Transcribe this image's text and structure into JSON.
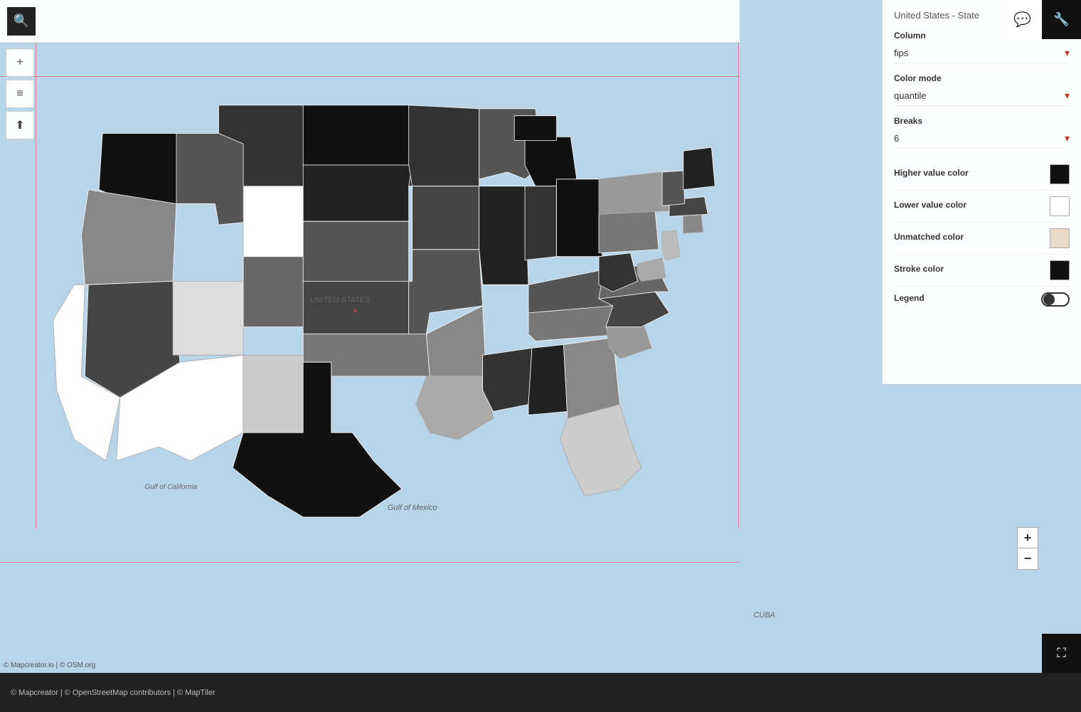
{
  "header": {
    "title": "United States - State"
  },
  "toolbar": {
    "search_icon": "🔍",
    "zoom_in_label": "+",
    "zoom_out_label": "−",
    "layers_icon": "≡",
    "upload_icon": "⬆",
    "settings_icon": "🔧",
    "comment_icon": "💬"
  },
  "panel": {
    "title": "United States - State",
    "column_label": "Column",
    "column_value": "fips",
    "color_mode_label": "Color mode",
    "color_mode_value": "quantile",
    "breaks_label": "Breaks",
    "breaks_value": "6",
    "higher_value_color_label": "Higher value color",
    "higher_value_color": "#111111",
    "lower_value_color_label": "Lower value color",
    "lower_value_color": "#ffffff",
    "unmatched_color_label": "Unmatched color",
    "unmatched_color": "#e8dcc8",
    "stroke_color_label": "Stroke color",
    "stroke_color": "#111111",
    "legend_label": "Legend",
    "legend_enabled": true
  },
  "map": {
    "label_us": "UNITED STATES",
    "label_gulf_california": "Gulf of California",
    "label_gulf_mexico": "Gulf of Mexico",
    "label_cuba": "CUBA"
  },
  "attribution": {
    "map_attribution": "© Mapcreator.io | © OSM.org",
    "bottom_attribution": "© Mapcreator | © OpenStreetMap contributors | © MapTiler"
  },
  "zoom": {
    "plus_label": "+",
    "minus_label": "−"
  }
}
